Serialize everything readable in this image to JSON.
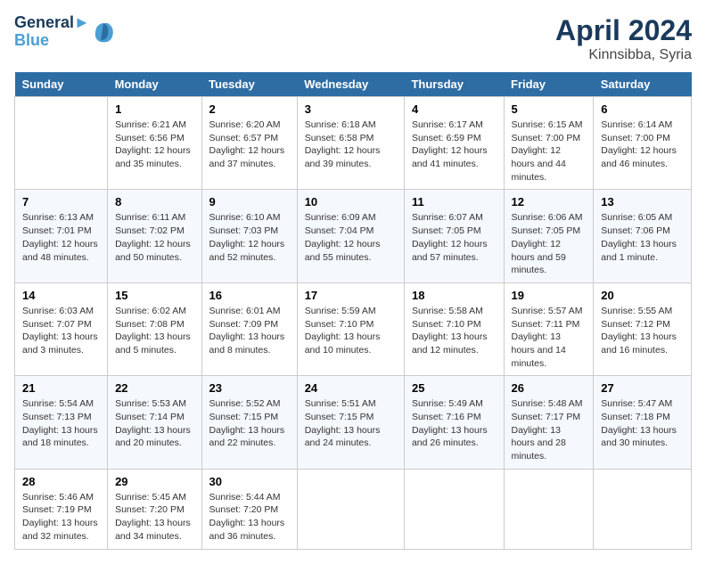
{
  "header": {
    "logo_line1": "General",
    "logo_line2": "Blue",
    "title": "April 2024",
    "subtitle": "Kinnsibba, Syria"
  },
  "days_of_week": [
    "Sunday",
    "Monday",
    "Tuesday",
    "Wednesday",
    "Thursday",
    "Friday",
    "Saturday"
  ],
  "weeks": [
    [
      {
        "day": "",
        "sunrise": "",
        "sunset": "",
        "daylight": ""
      },
      {
        "day": "1",
        "sunrise": "6:21 AM",
        "sunset": "6:56 PM",
        "daylight": "12 hours and 35 minutes."
      },
      {
        "day": "2",
        "sunrise": "6:20 AM",
        "sunset": "6:57 PM",
        "daylight": "12 hours and 37 minutes."
      },
      {
        "day": "3",
        "sunrise": "6:18 AM",
        "sunset": "6:58 PM",
        "daylight": "12 hours and 39 minutes."
      },
      {
        "day": "4",
        "sunrise": "6:17 AM",
        "sunset": "6:59 PM",
        "daylight": "12 hours and 41 minutes."
      },
      {
        "day": "5",
        "sunrise": "6:15 AM",
        "sunset": "7:00 PM",
        "daylight": "12 hours and 44 minutes."
      },
      {
        "day": "6",
        "sunrise": "6:14 AM",
        "sunset": "7:00 PM",
        "daylight": "12 hours and 46 minutes."
      }
    ],
    [
      {
        "day": "7",
        "sunrise": "6:13 AM",
        "sunset": "7:01 PM",
        "daylight": "12 hours and 48 minutes."
      },
      {
        "day": "8",
        "sunrise": "6:11 AM",
        "sunset": "7:02 PM",
        "daylight": "12 hours and 50 minutes."
      },
      {
        "day": "9",
        "sunrise": "6:10 AM",
        "sunset": "7:03 PM",
        "daylight": "12 hours and 52 minutes."
      },
      {
        "day": "10",
        "sunrise": "6:09 AM",
        "sunset": "7:04 PM",
        "daylight": "12 hours and 55 minutes."
      },
      {
        "day": "11",
        "sunrise": "6:07 AM",
        "sunset": "7:05 PM",
        "daylight": "12 hours and 57 minutes."
      },
      {
        "day": "12",
        "sunrise": "6:06 AM",
        "sunset": "7:05 PM",
        "daylight": "12 hours and 59 minutes."
      },
      {
        "day": "13",
        "sunrise": "6:05 AM",
        "sunset": "7:06 PM",
        "daylight": "13 hours and 1 minute."
      }
    ],
    [
      {
        "day": "14",
        "sunrise": "6:03 AM",
        "sunset": "7:07 PM",
        "daylight": "13 hours and 3 minutes."
      },
      {
        "day": "15",
        "sunrise": "6:02 AM",
        "sunset": "7:08 PM",
        "daylight": "13 hours and 5 minutes."
      },
      {
        "day": "16",
        "sunrise": "6:01 AM",
        "sunset": "7:09 PM",
        "daylight": "13 hours and 8 minutes."
      },
      {
        "day": "17",
        "sunrise": "5:59 AM",
        "sunset": "7:10 PM",
        "daylight": "13 hours and 10 minutes."
      },
      {
        "day": "18",
        "sunrise": "5:58 AM",
        "sunset": "7:10 PM",
        "daylight": "13 hours and 12 minutes."
      },
      {
        "day": "19",
        "sunrise": "5:57 AM",
        "sunset": "7:11 PM",
        "daylight": "13 hours and 14 minutes."
      },
      {
        "day": "20",
        "sunrise": "5:55 AM",
        "sunset": "7:12 PM",
        "daylight": "13 hours and 16 minutes."
      }
    ],
    [
      {
        "day": "21",
        "sunrise": "5:54 AM",
        "sunset": "7:13 PM",
        "daylight": "13 hours and 18 minutes."
      },
      {
        "day": "22",
        "sunrise": "5:53 AM",
        "sunset": "7:14 PM",
        "daylight": "13 hours and 20 minutes."
      },
      {
        "day": "23",
        "sunrise": "5:52 AM",
        "sunset": "7:15 PM",
        "daylight": "13 hours and 22 minutes."
      },
      {
        "day": "24",
        "sunrise": "5:51 AM",
        "sunset": "7:15 PM",
        "daylight": "13 hours and 24 minutes."
      },
      {
        "day": "25",
        "sunrise": "5:49 AM",
        "sunset": "7:16 PM",
        "daylight": "13 hours and 26 minutes."
      },
      {
        "day": "26",
        "sunrise": "5:48 AM",
        "sunset": "7:17 PM",
        "daylight": "13 hours and 28 minutes."
      },
      {
        "day": "27",
        "sunrise": "5:47 AM",
        "sunset": "7:18 PM",
        "daylight": "13 hours and 30 minutes."
      }
    ],
    [
      {
        "day": "28",
        "sunrise": "5:46 AM",
        "sunset": "7:19 PM",
        "daylight": "13 hours and 32 minutes."
      },
      {
        "day": "29",
        "sunrise": "5:45 AM",
        "sunset": "7:20 PM",
        "daylight": "13 hours and 34 minutes."
      },
      {
        "day": "30",
        "sunrise": "5:44 AM",
        "sunset": "7:20 PM",
        "daylight": "13 hours and 36 minutes."
      },
      {
        "day": "",
        "sunrise": "",
        "sunset": "",
        "daylight": ""
      },
      {
        "day": "",
        "sunrise": "",
        "sunset": "",
        "daylight": ""
      },
      {
        "day": "",
        "sunrise": "",
        "sunset": "",
        "daylight": ""
      },
      {
        "day": "",
        "sunrise": "",
        "sunset": "",
        "daylight": ""
      }
    ]
  ]
}
